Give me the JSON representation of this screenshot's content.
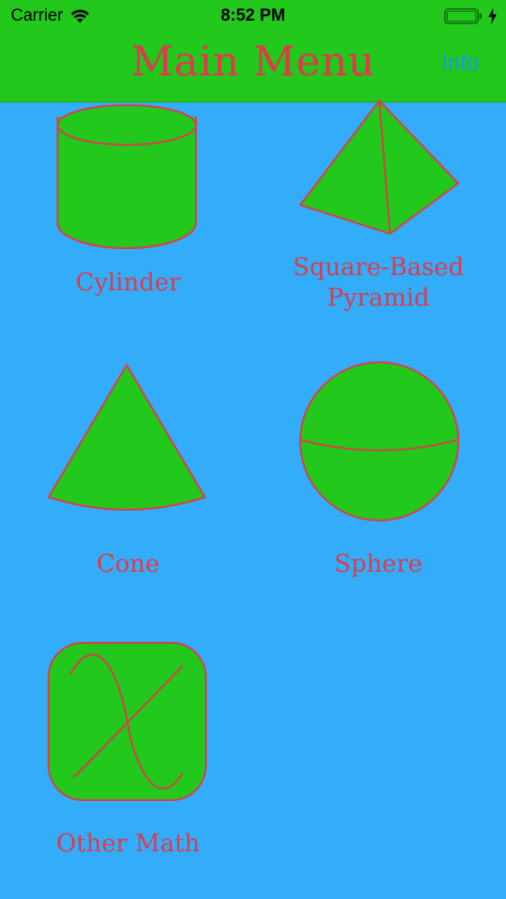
{
  "status_bar": {
    "carrier": "Carrier",
    "time": "8:52 PM",
    "wifi_icon": "wifi-icon",
    "battery_icon": "battery-icon",
    "charging_icon": "bolt-icon"
  },
  "nav": {
    "title": "Main Menu",
    "info_label": "Info"
  },
  "menu": {
    "items": [
      {
        "label": "Cylinder",
        "icon": "cylinder-icon"
      },
      {
        "label_line1": "Square-Based",
        "label_line2": "Pyramid",
        "icon": "pyramid-icon"
      },
      {
        "label": "Cone",
        "icon": "cone-icon"
      },
      {
        "label": "Sphere",
        "icon": "sphere-icon"
      },
      {
        "label": "Other Math",
        "icon": "other-math-icon"
      }
    ]
  },
  "colors": {
    "background": "#33adf9",
    "nav_bar": "#22c81c",
    "shape_fill": "#22c81c",
    "shape_stroke": "#e0394b",
    "label_text": "#e0394b",
    "info_text": "#1598e6"
  }
}
